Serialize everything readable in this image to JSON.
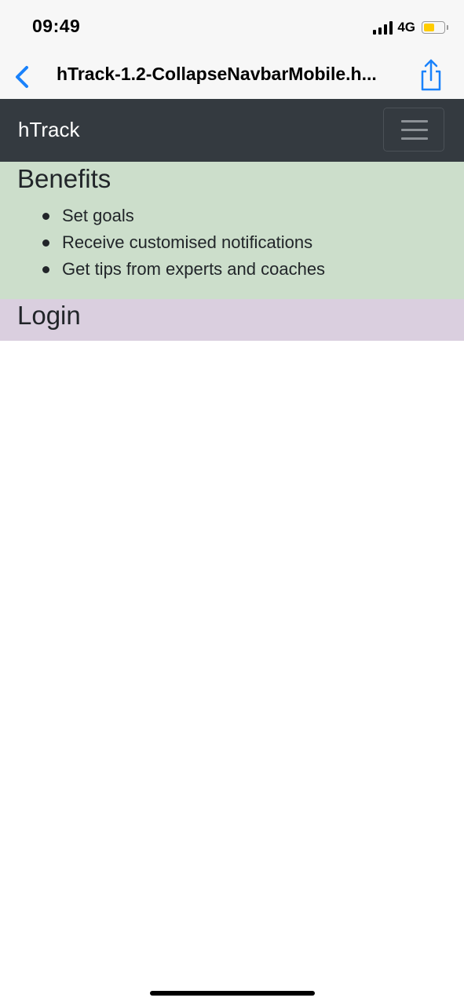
{
  "status_bar": {
    "time": "09:49",
    "network": "4G",
    "signal_icon": "cellular-signal-icon",
    "battery_icon": "battery-icon",
    "battery_level": 0.48,
    "battery_color": "#ffcc00"
  },
  "browser": {
    "back_icon": "chevron-left-icon",
    "title": "hTrack-1.2-CollapseNavbarMobile.h...",
    "share_icon": "share-icon",
    "accent_color": "#1a82fb"
  },
  "navbar": {
    "brand": "hTrack",
    "toggler_icon": "hamburger-menu-icon",
    "background": "#343a40"
  },
  "benefits": {
    "heading": "Benefits",
    "items": [
      "Set goals",
      "Receive customised notifications",
      "Get tips from experts and coaches"
    ],
    "background": "#ccdecb"
  },
  "login": {
    "heading": "Login",
    "background": "#dacfdf"
  }
}
